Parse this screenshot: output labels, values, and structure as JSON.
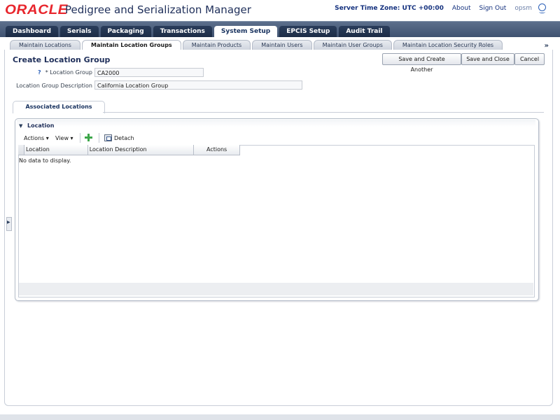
{
  "header": {
    "logo": "ORACLE",
    "title": "Pedigree and Serialization Manager",
    "server_time": "Server Time Zone: UTC +00:00",
    "about": "About",
    "sign_out": "Sign Out",
    "user": "opsm"
  },
  "main_tabs": [
    {
      "label": "Dashboard",
      "active": false
    },
    {
      "label": "Serials",
      "active": false
    },
    {
      "label": "Packaging",
      "active": false
    },
    {
      "label": "Transactions",
      "active": false
    },
    {
      "label": "System Setup",
      "active": true
    },
    {
      "label": "EPCIS Setup",
      "active": false
    },
    {
      "label": "Audit Trail",
      "active": false
    }
  ],
  "sub_tabs": [
    {
      "label": "Maintain Locations",
      "active": false
    },
    {
      "label": "Maintain Location Groups",
      "active": true
    },
    {
      "label": "Maintain Products",
      "active": false
    },
    {
      "label": "Maintain Users",
      "active": false
    },
    {
      "label": "Maintain User Groups",
      "active": false
    },
    {
      "label": "Maintain Location Security Roles",
      "active": false
    }
  ],
  "more_tabs": "»",
  "page": {
    "title": "Create Location Group",
    "buttons": {
      "save_create": "Save and Create Another",
      "save_close": "Save and Close",
      "cancel": "Cancel"
    },
    "form": {
      "help": "?",
      "group_label": "* Location Group",
      "group_value": "CA2000",
      "desc_label": "Location Group Description",
      "desc_value": "California Location Group"
    },
    "assoc_tab": "Associated Locations",
    "panel": {
      "toggle": "▼",
      "title": "Location",
      "actions": "Actions ▾",
      "view": "View ▾",
      "detach": "Detach",
      "columns": [
        "Location",
        "Location Description",
        "Actions"
      ],
      "empty": "No data to display."
    }
  }
}
